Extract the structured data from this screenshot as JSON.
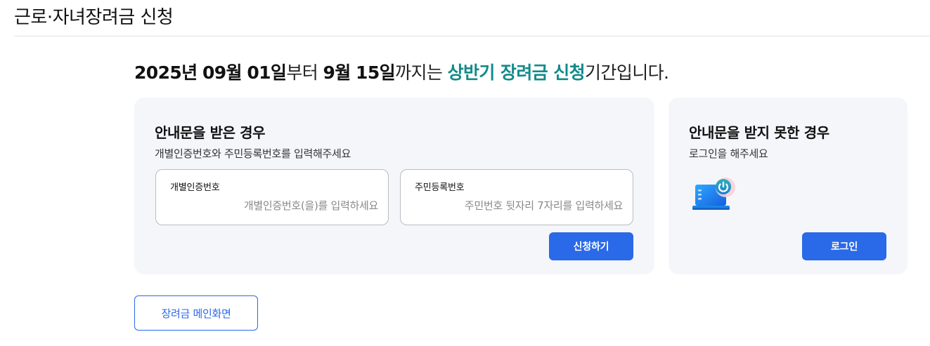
{
  "page": {
    "title": "근로·자녀장려금 신청"
  },
  "period": {
    "start_year": "2025년",
    "start_month": "09월",
    "start_day": "01일",
    "from_word": "부터",
    "end_month": "9월",
    "end_day": "15일",
    "until_word": "까지는",
    "period_name": "상반기 장려금 신청",
    "suffix": "기간입니다."
  },
  "with_notice": {
    "heading": "안내문을 받은 경우",
    "subtext": "개별인증번호와 주민등록번호를 입력해주세요",
    "auth_field": {
      "label": "개별인증번호",
      "value": "",
      "placeholder": "개별인증번호(을)를 입력하세요"
    },
    "rrn_field": {
      "label": "주민등록번호",
      "value": "",
      "placeholder": "주민번호 뒷자리 7자리를 입력하세요"
    },
    "submit_label": "신청하기"
  },
  "without_notice": {
    "heading": "안내문을 받지 못한 경우",
    "subtext": "로그인을 해주세요",
    "illustration_icon": "laptop-power-icon",
    "login_label": "로그인"
  },
  "footer": {
    "main_link_label": "장려금 메인화면"
  },
  "colors": {
    "accent_teal": "#138a8a",
    "primary_blue": "#2a69e8",
    "card_bg": "#f5f6fa"
  }
}
